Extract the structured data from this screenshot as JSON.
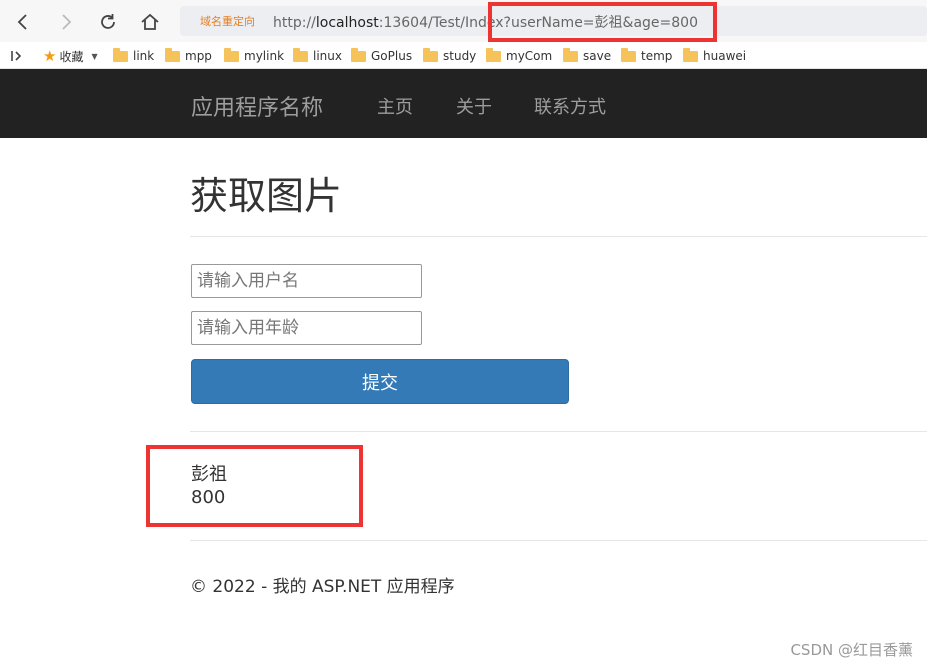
{
  "browser": {
    "address_label": "域名重定向",
    "url_prefix": "http://",
    "url_host": "localhost",
    "url_rest": ":13604/Test/Index?userName=彭祖&age=800",
    "bookmarks_label": "收藏",
    "bookmarks": [
      "link",
      "mpp",
      "mylink",
      "linux",
      "GoPlus",
      "study",
      "myCom",
      "save",
      "temp",
      "huawei"
    ]
  },
  "navbar": {
    "brand": "应用程序名称",
    "links": [
      "主页",
      "关于",
      "联系方式"
    ]
  },
  "main": {
    "title": "获取图片",
    "username_placeholder": "请输入用户名",
    "age_placeholder": "请输入用年龄",
    "submit_label": "提交",
    "result_name": "彭祖",
    "result_age": "800"
  },
  "footer": {
    "text": "© 2022 - 我的 ASP.NET 应用程序"
  },
  "watermark": "CSDN @红目香薰"
}
